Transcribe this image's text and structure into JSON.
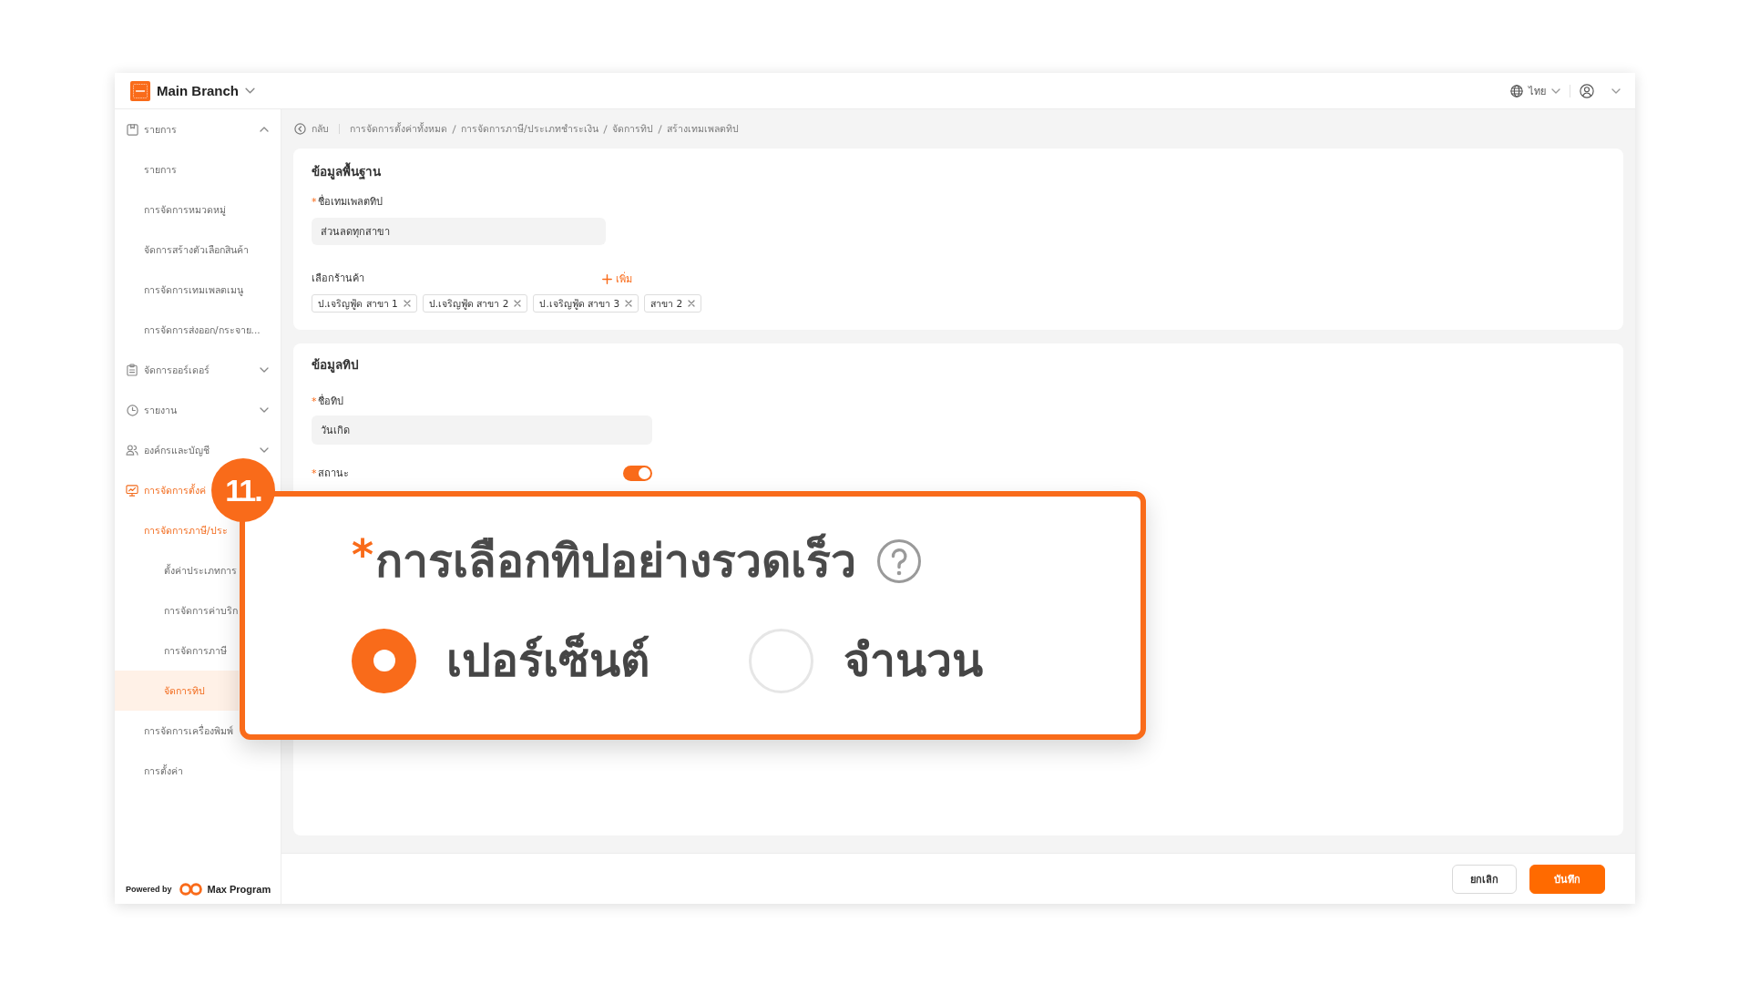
{
  "topbar": {
    "branch": "Main Branch",
    "language": "ไทย"
  },
  "sidebar": {
    "items": [
      {
        "label": "รายการ",
        "selected": false,
        "expanded": true,
        "children": [
          {
            "label": "รายการ",
            "selected": false
          },
          {
            "label": "การจัดการหมวดหมู่",
            "selected": false
          },
          {
            "label": "จัดการสร้างตัวเลือกสินค้า",
            "selected": false
          },
          {
            "label": "การจัดการเทมเพลตเมนู",
            "selected": false
          },
          {
            "label": "การจัดการส่งออก/กระจาย...",
            "selected": false
          }
        ]
      },
      {
        "label": "จัดการออร์เดอร์",
        "selected": false,
        "expanded": false
      },
      {
        "label": "รายงาน",
        "selected": false,
        "expanded": false
      },
      {
        "label": "องค์กรและบัญชี",
        "selected": false,
        "expanded": false
      },
      {
        "label": "การจัดการตั้งค่",
        "selected": false,
        "children": [
          {
            "label": "การจัดการภาษี/ประ",
            "selected": false,
            "children": [
              {
                "label": "ตั้งค่าประเภทการ",
                "selected": false
              },
              {
                "label": "การจัดการค่าบริก",
                "selected": false
              },
              {
                "label": "การจัดการภาษี",
                "selected": false
              },
              {
                "label": "จัดการทิป",
                "selected": true
              }
            ]
          },
          {
            "label": "การจัดการเครื่องพิมพ์",
            "selected": false
          },
          {
            "label": "การตั้งค่า",
            "selected": false
          }
        ]
      }
    ],
    "footer": {
      "powered_by": "Powered by",
      "brand": "Max Program"
    }
  },
  "breadcrumb": {
    "back": "กลับ",
    "items": [
      "การจัดการตั้งค่าทั้งหมด",
      "การจัดการภาษี/ประเภทชำระเงิน",
      "จัดการทิป",
      "สร้างเทมเพลตทิป"
    ]
  },
  "basic_info": {
    "title": "ข้อมูลพื้นฐาน",
    "template_name": {
      "required_mark": "*",
      "label": "ชื่อเทมเพลตทิป",
      "value": "ส่วนลดทุกสาขา"
    },
    "stores": {
      "label": "เลือกร้านค้า",
      "add": "เพิ่ม",
      "tags": [
        "ป.เจริญฟู้ด สาขา 1",
        "ป.เจริญฟู้ด สาขา 2",
        "ป.เจริญฟู้ด สาขา 3",
        "สาขา 2"
      ]
    }
  },
  "tip_info": {
    "title": "ข้อมูลทิป",
    "tip_name": {
      "required_mark": "*",
      "label": "ชื่อทิป",
      "value": "วันเกิด"
    },
    "status": {
      "required_mark": "*",
      "label": "สถานะ",
      "on": true
    }
  },
  "callout": {
    "number": "11.",
    "required_mark": "*",
    "label": "การเลือกทิปอย่างรวดเร็ว",
    "options": [
      {
        "label": "เปอร์เซ็นต์",
        "selected": true
      },
      {
        "label": "จำนวน",
        "selected": false
      }
    ]
  },
  "actions": [
    {
      "label": "ยกเลิก",
      "kind": "secondary"
    },
    {
      "label": "บันทึก",
      "kind": "primary"
    }
  ]
}
